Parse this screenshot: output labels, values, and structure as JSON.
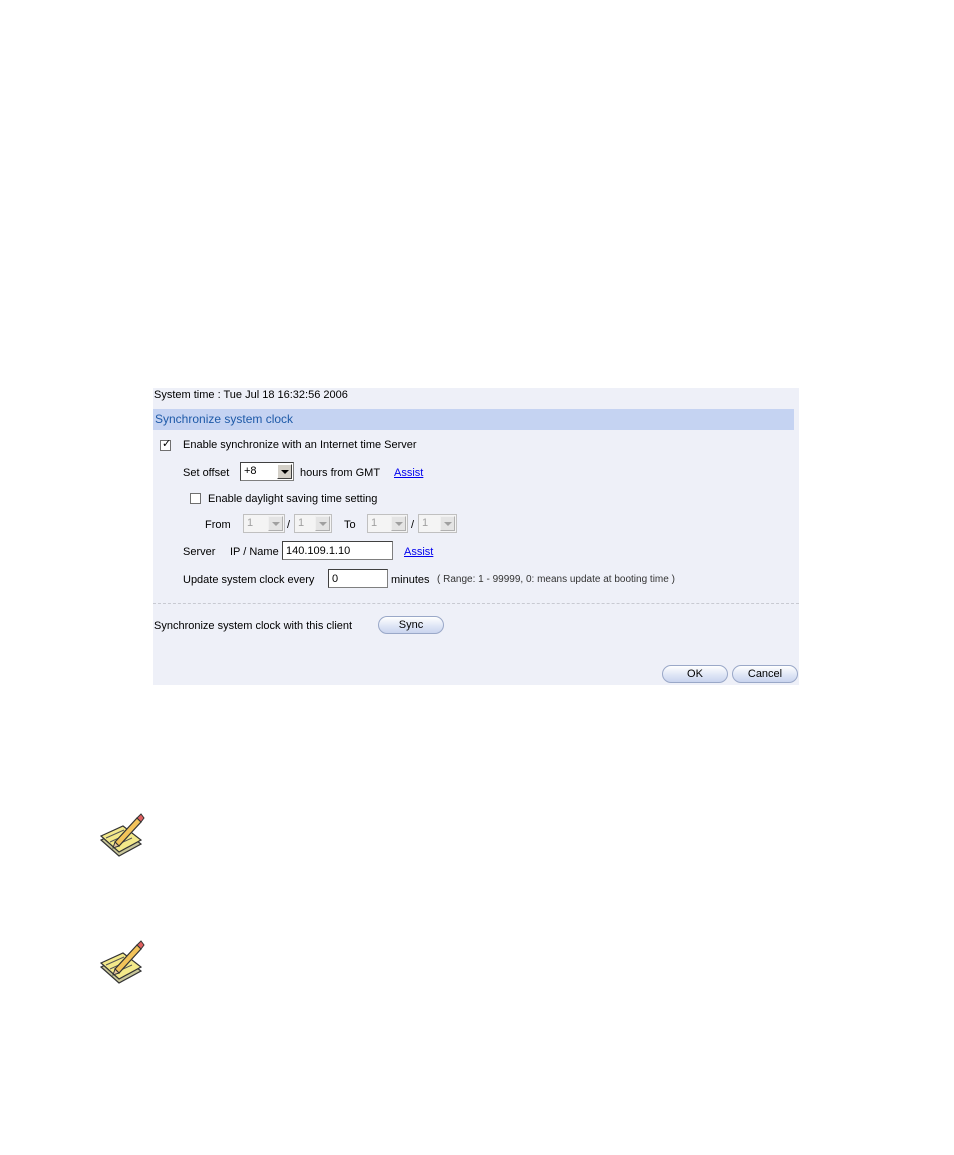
{
  "system_time": "System time : Tue Jul 18 16:32:56 2006",
  "section_title": "Synchronize system clock",
  "enable_sync": {
    "label": "Enable synchronize with an Internet time Server",
    "checked": true
  },
  "offset": {
    "label": "Set offset",
    "value": "+8",
    "suffix": "hours from GMT",
    "assist": "Assist"
  },
  "dst": {
    "label": "Enable daylight saving time setting",
    "checked": false
  },
  "range": {
    "from_label": "From",
    "to_label": "To",
    "slash": "/",
    "from_month": "1",
    "from_day": "1",
    "to_month": "1",
    "to_day": "1"
  },
  "server": {
    "label": "Server",
    "sublabel": "IP / Name",
    "value": "140.109.1.10",
    "assist": "Assist"
  },
  "update": {
    "label": "Update system clock every",
    "value": "0",
    "unit": "minutes",
    "hint": "( Range: 1 - 99999, 0: means update at booting time )"
  },
  "client_sync": {
    "label": "Synchronize system clock with this client",
    "button": "Sync"
  },
  "actions": {
    "ok": "OK",
    "cancel": "Cancel"
  },
  "icons": [
    "note-pencil-icon",
    "note-pencil-icon"
  ]
}
